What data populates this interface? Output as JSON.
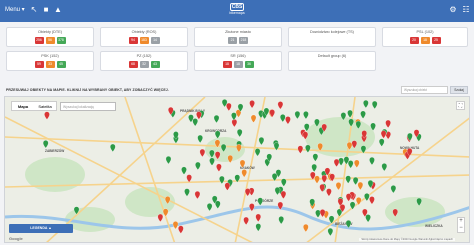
{
  "topbar": {
    "menu_label": "Menu ▾",
    "brand_logo": "CBS",
    "brand_sub": "bikemapa",
    "icons": [
      "arrow-icon",
      "lock-icon",
      "user-icon",
      "gear-icon",
      "grid-icon"
    ]
  },
  "cards": [
    {
      "title": "Obiekty (DTE)",
      "pills": [
        {
          "c": "r",
          "v": "256"
        },
        {
          "c": "o",
          "v": "56"
        },
        {
          "c": "g",
          "v": "378"
        }
      ]
    },
    {
      "title": "Obiekty (ROS)",
      "pills": [
        {
          "c": "r",
          "v": "94"
        },
        {
          "c": "o",
          "v": "183"
        },
        {
          "c": "x",
          "v": "14"
        }
      ]
    },
    {
      "title": "Złożone miasto",
      "pills": [
        {
          "c": "x",
          "v": "21"
        },
        {
          "c": "x",
          "v": "218"
        }
      ]
    },
    {
      "title": "Dowództwo kolejowe (TS)",
      "pills": []
    },
    {
      "title": "PSL (102)",
      "pills": [
        {
          "c": "r",
          "v": "20"
        },
        {
          "c": "o",
          "v": "18"
        },
        {
          "c": "r",
          "v": "25"
        }
      ]
    },
    {
      "title": "PSK (152)",
      "pills": [
        {
          "c": "r",
          "v": "59"
        },
        {
          "c": "o",
          "v": "33"
        },
        {
          "c": "g",
          "v": "45"
        }
      ]
    },
    {
      "title": "PZ (152)",
      "pills": [
        {
          "c": "r",
          "v": "68"
        },
        {
          "c": "x",
          "v": "32"
        },
        {
          "c": "g",
          "v": "43"
        }
      ]
    },
    {
      "title": "SR (156)",
      "pills": [
        {
          "c": "r",
          "v": "18"
        },
        {
          "c": "x",
          "v": "18"
        },
        {
          "c": "g",
          "v": "36"
        }
      ]
    },
    {
      "title": "Default group (6)",
      "pills": []
    }
  ],
  "instruction": "PRZESUWAJ OBIEKTY NA MAPIE. KLIKNIJ NA WYBRANY OBIEKT, ABY ZOBACZYĆ WIĘCEJ.",
  "search_placeholder": "Wyszukaj obiekt",
  "search_button": "Szukaj",
  "map": {
    "tabs": [
      "Mapa",
      "Satelita"
    ],
    "search_placeholder": "Wyszukaj lokalizację",
    "legend_button": "LEGENDA ▲",
    "google": "Google",
    "attribution": "Skróty klawiszowe  Dane do Mapy ©2023 Google  Warunki  Zgłoś błąd w mapach",
    "labels": [
      "KRAKÓW",
      "NOWA HUTA",
      "KROWODRZA",
      "BIEŻANÓW",
      "PODGÓRZE",
      "ZABIERZÓW",
      "WIELICZKA",
      "PRĄDNIK BIAŁY"
    ],
    "colors": {
      "red": "#d93636",
      "orange": "#ef8a2c",
      "green": "#2c9a47",
      "road": "#f6d38c",
      "park": "#cfe6c6",
      "water": "#9cc6ea"
    }
  }
}
